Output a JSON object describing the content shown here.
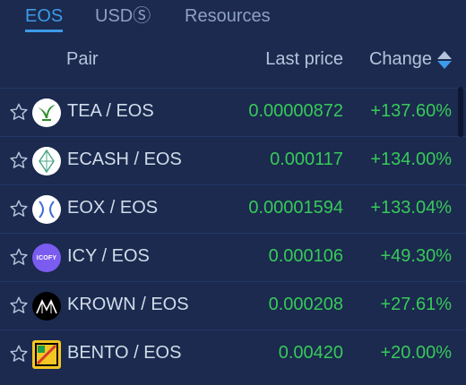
{
  "tabs": [
    {
      "label": "EOS",
      "active": true
    },
    {
      "label": "USDⓈ",
      "active": false
    },
    {
      "label": "Resources",
      "active": false
    }
  ],
  "header": {
    "pair": "Pair",
    "last_price": "Last price",
    "change": "Change"
  },
  "rows": [
    {
      "pair": "TEA / EOS",
      "price": "0.00000872",
      "change": "+137.60%",
      "icon": "tea-logo-icon"
    },
    {
      "pair": "ECASH / EOS",
      "price": "0.000117",
      "change": "+134.00%",
      "icon": "ecash-logo-icon"
    },
    {
      "pair": "EOX / EOS",
      "price": "0.00001594",
      "change": "+133.04%",
      "icon": "eox-logo-icon"
    },
    {
      "pair": "ICY / EOS",
      "price": "0.000106",
      "change": "+49.30%",
      "icon": "icy-logo-icon",
      "logo_text": "ICOFY"
    },
    {
      "pair": "KROWN / EOS",
      "price": "0.000208",
      "change": "+27.61%",
      "icon": "krown-logo-icon"
    },
    {
      "pair": "BENTO / EOS",
      "price": "0.00420",
      "change": "+20.00%",
      "icon": "bento-logo-icon"
    }
  ],
  "colors": {
    "background": "#1b2a4e",
    "accent": "#3d9be9",
    "positive": "#37c95a"
  }
}
